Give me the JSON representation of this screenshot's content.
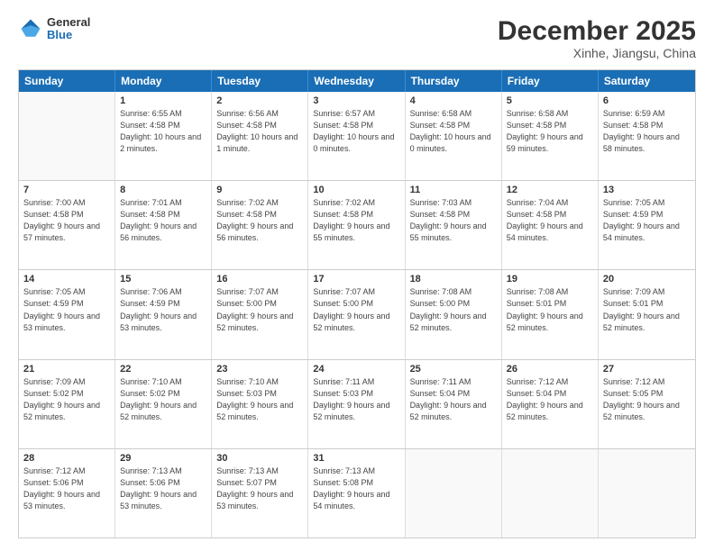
{
  "header": {
    "logo_general": "General",
    "logo_blue": "Blue",
    "month_title": "December 2025",
    "location": "Xinhe, Jiangsu, China"
  },
  "days_of_week": [
    "Sunday",
    "Monday",
    "Tuesday",
    "Wednesday",
    "Thursday",
    "Friday",
    "Saturday"
  ],
  "weeks": [
    [
      {
        "day": "",
        "sunrise": "",
        "sunset": "",
        "daylight": ""
      },
      {
        "day": "1",
        "sunrise": "6:55 AM",
        "sunset": "4:58 PM",
        "daylight": "10 hours and 2 minutes."
      },
      {
        "day": "2",
        "sunrise": "6:56 AM",
        "sunset": "4:58 PM",
        "daylight": "10 hours and 1 minute."
      },
      {
        "day": "3",
        "sunrise": "6:57 AM",
        "sunset": "4:58 PM",
        "daylight": "10 hours and 0 minutes."
      },
      {
        "day": "4",
        "sunrise": "6:58 AM",
        "sunset": "4:58 PM",
        "daylight": "10 hours and 0 minutes."
      },
      {
        "day": "5",
        "sunrise": "6:58 AM",
        "sunset": "4:58 PM",
        "daylight": "9 hours and 59 minutes."
      },
      {
        "day": "6",
        "sunrise": "6:59 AM",
        "sunset": "4:58 PM",
        "daylight": "9 hours and 58 minutes."
      }
    ],
    [
      {
        "day": "7",
        "sunrise": "7:00 AM",
        "sunset": "4:58 PM",
        "daylight": "9 hours and 57 minutes."
      },
      {
        "day": "8",
        "sunrise": "7:01 AM",
        "sunset": "4:58 PM",
        "daylight": "9 hours and 56 minutes."
      },
      {
        "day": "9",
        "sunrise": "7:02 AM",
        "sunset": "4:58 PM",
        "daylight": "9 hours and 56 minutes."
      },
      {
        "day": "10",
        "sunrise": "7:02 AM",
        "sunset": "4:58 PM",
        "daylight": "9 hours and 55 minutes."
      },
      {
        "day": "11",
        "sunrise": "7:03 AM",
        "sunset": "4:58 PM",
        "daylight": "9 hours and 55 minutes."
      },
      {
        "day": "12",
        "sunrise": "7:04 AM",
        "sunset": "4:58 PM",
        "daylight": "9 hours and 54 minutes."
      },
      {
        "day": "13",
        "sunrise": "7:05 AM",
        "sunset": "4:59 PM",
        "daylight": "9 hours and 54 minutes."
      }
    ],
    [
      {
        "day": "14",
        "sunrise": "7:05 AM",
        "sunset": "4:59 PM",
        "daylight": "9 hours and 53 minutes."
      },
      {
        "day": "15",
        "sunrise": "7:06 AM",
        "sunset": "4:59 PM",
        "daylight": "9 hours and 53 minutes."
      },
      {
        "day": "16",
        "sunrise": "7:07 AM",
        "sunset": "5:00 PM",
        "daylight": "9 hours and 52 minutes."
      },
      {
        "day": "17",
        "sunrise": "7:07 AM",
        "sunset": "5:00 PM",
        "daylight": "9 hours and 52 minutes."
      },
      {
        "day": "18",
        "sunrise": "7:08 AM",
        "sunset": "5:00 PM",
        "daylight": "9 hours and 52 minutes."
      },
      {
        "day": "19",
        "sunrise": "7:08 AM",
        "sunset": "5:01 PM",
        "daylight": "9 hours and 52 minutes."
      },
      {
        "day": "20",
        "sunrise": "7:09 AM",
        "sunset": "5:01 PM",
        "daylight": "9 hours and 52 minutes."
      }
    ],
    [
      {
        "day": "21",
        "sunrise": "7:09 AM",
        "sunset": "5:02 PM",
        "daylight": "9 hours and 52 minutes."
      },
      {
        "day": "22",
        "sunrise": "7:10 AM",
        "sunset": "5:02 PM",
        "daylight": "9 hours and 52 minutes."
      },
      {
        "day": "23",
        "sunrise": "7:10 AM",
        "sunset": "5:03 PM",
        "daylight": "9 hours and 52 minutes."
      },
      {
        "day": "24",
        "sunrise": "7:11 AM",
        "sunset": "5:03 PM",
        "daylight": "9 hours and 52 minutes."
      },
      {
        "day": "25",
        "sunrise": "7:11 AM",
        "sunset": "5:04 PM",
        "daylight": "9 hours and 52 minutes."
      },
      {
        "day": "26",
        "sunrise": "7:12 AM",
        "sunset": "5:04 PM",
        "daylight": "9 hours and 52 minutes."
      },
      {
        "day": "27",
        "sunrise": "7:12 AM",
        "sunset": "5:05 PM",
        "daylight": "9 hours and 52 minutes."
      }
    ],
    [
      {
        "day": "28",
        "sunrise": "7:12 AM",
        "sunset": "5:06 PM",
        "daylight": "9 hours and 53 minutes."
      },
      {
        "day": "29",
        "sunrise": "7:13 AM",
        "sunset": "5:06 PM",
        "daylight": "9 hours and 53 minutes."
      },
      {
        "day": "30",
        "sunrise": "7:13 AM",
        "sunset": "5:07 PM",
        "daylight": "9 hours and 53 minutes."
      },
      {
        "day": "31",
        "sunrise": "7:13 AM",
        "sunset": "5:08 PM",
        "daylight": "9 hours and 54 minutes."
      },
      {
        "day": "",
        "sunrise": "",
        "sunset": "",
        "daylight": ""
      },
      {
        "day": "",
        "sunrise": "",
        "sunset": "",
        "daylight": ""
      },
      {
        "day": "",
        "sunrise": "",
        "sunset": "",
        "daylight": ""
      }
    ]
  ],
  "labels": {
    "sunrise_prefix": "Sunrise: ",
    "sunset_prefix": "Sunset: ",
    "daylight_prefix": "Daylight: "
  }
}
